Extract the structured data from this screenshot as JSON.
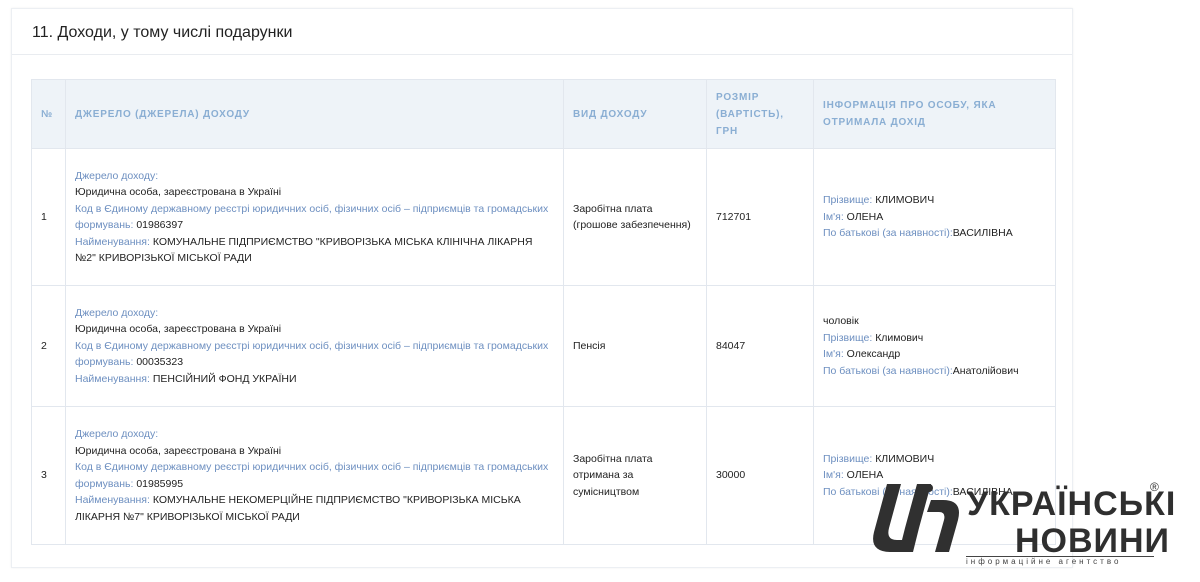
{
  "section": {
    "title": "11. Доходи, у тому числі подарунки"
  },
  "table": {
    "headers": {
      "num": "№",
      "source": "ДЖЕРЕЛО (ДЖЕРЕЛА) ДОХОДУ",
      "type": "ВИД ДОХОДУ",
      "amount": "РОЗМІР (ВАРТІСТЬ), ГРН",
      "person": "ІНФОРМАЦІЯ ПРО ОСОБУ, ЯКА ОТРИМАЛА ДОХІД"
    },
    "labels": {
      "source_title": "Джерело доходу:",
      "code": "Код в Єдиному державному реєстрі юридичних осіб, фізичних осіб – підприємців та громадських формувань:",
      "name": "Найменування:",
      "surname": "Прізвище:",
      "first_name": "Ім'я:",
      "patronymic": "По батькові (за наявності):"
    },
    "rows": [
      {
        "num": "1",
        "entity": "Юридична особа, зареєстрована в Україні",
        "code": "01986397",
        "name": "КОМУНАЛЬНЕ ПІДПРИЄМСТВО \"КРИВОРІЗЬКА МІСЬКА КЛІНІЧНА ЛІКАРНЯ №2\" КРИВОРІЗЬКОЇ МІСЬКОЇ РАДИ",
        "income_type": "Заробітна плата (грошове забезпечення)",
        "amount": "712701",
        "relation": "",
        "surname": "КЛИМОВИЧ",
        "first_name": "ОЛЕНА",
        "patronymic": "ВАСИЛІВНА"
      },
      {
        "num": "2",
        "entity": "Юридична особа, зареєстрована в Україні",
        "code": "00035323",
        "name": "ПЕНСІЙНИЙ ФОНД УКРАЇНИ",
        "income_type": "Пенсія",
        "amount": "84047",
        "relation": "чоловік",
        "surname": "Климович",
        "first_name": "Олександр",
        "patronymic": "Анатолійович"
      },
      {
        "num": "3",
        "entity": "Юридична особа, зареєстрована в Україні",
        "code": "01985995",
        "name": "КОМУНАЛЬНЕ НЕКОМЕРЦІЙНЕ ПІДПРИЄМСТВО \"КРИВОРІЗЬКА МІСЬКА ЛІКАРНЯ №7\" КРИВОРІЗЬКОЇ МІСЬКОЇ РАДИ",
        "income_type": "Заробітна плата отримана за сумісництвом",
        "amount": "30000",
        "relation": "",
        "surname": "КЛИМОВИЧ",
        "first_name": "ОЛЕНА",
        "patronymic": "ВАСИЛІВНА"
      }
    ]
  },
  "watermark": {
    "line1": "УКРАЇНСЬКІ",
    "line2": "НОВИНИ",
    "tagline": "інформаційне агентство",
    "registered": "®",
    "logo_icon": "un-logo-icon"
  },
  "colors": {
    "label": "#6d8fc0",
    "header_text": "#8aaed3",
    "header_bg": "#eef3f8",
    "border": "#e2e7ee"
  }
}
